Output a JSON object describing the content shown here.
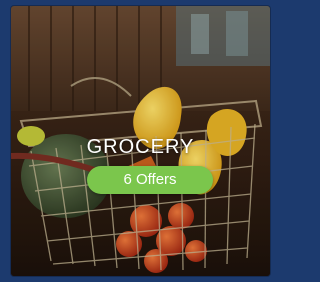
{
  "category_card": {
    "title": "GROCERY",
    "offers_label": "6 Offers",
    "image_icon": "grocery-basket-photo",
    "badge_color": "#7bc64c",
    "frame_color": "#1c3a6e"
  }
}
